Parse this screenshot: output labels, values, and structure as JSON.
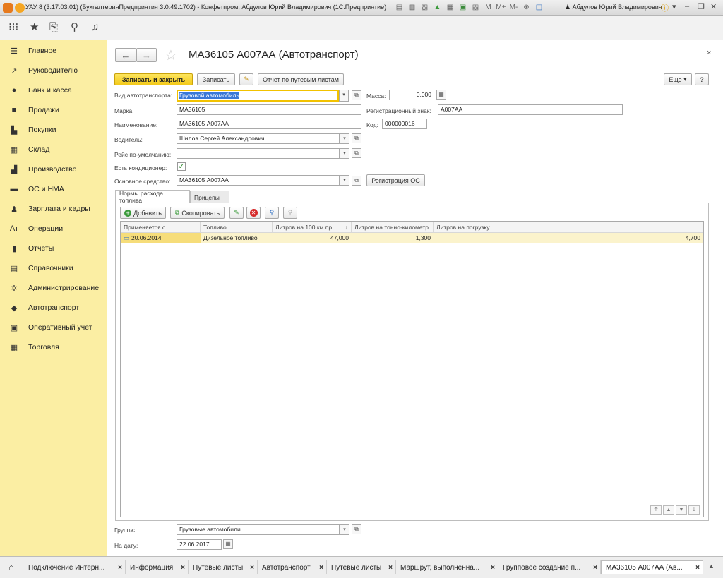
{
  "window": {
    "title": "УАУ 8 (3.17.03.01) (БухгалтерияПредприятия 3.0.49.1702) - Конфетпром, Абдулов Юрий Владимирович  (1С:Предприятие)",
    "user": "Абдулов Юрий Владимирович"
  },
  "sidebar": {
    "items": [
      {
        "label": "Главное",
        "icon": "menu-icon"
      },
      {
        "label": "Руководителю",
        "icon": "trend-icon"
      },
      {
        "label": "Банк и касса",
        "icon": "coin-icon"
      },
      {
        "label": "Продажи",
        "icon": "bag-icon"
      },
      {
        "label": "Покупки",
        "icon": "cart-icon"
      },
      {
        "label": "Склад",
        "icon": "warehouse-icon"
      },
      {
        "label": "Производство",
        "icon": "factory-icon"
      },
      {
        "label": "ОС и НМА",
        "icon": "truck-icon"
      },
      {
        "label": "Зарплата и кадры",
        "icon": "person-icon"
      },
      {
        "label": "Операции",
        "icon": "operations-icon"
      },
      {
        "label": "Отчеты",
        "icon": "bar-chart-icon"
      },
      {
        "label": "Справочники",
        "icon": "book-icon"
      },
      {
        "label": "Администрирование",
        "icon": "gear-icon"
      },
      {
        "label": "Автотранспорт",
        "icon": "car-icon"
      },
      {
        "label": "Оперативный учет",
        "icon": "register-icon"
      },
      {
        "label": "Торговля",
        "icon": "grid-icon"
      }
    ]
  },
  "form": {
    "title": "МА36105 А007АА (Автотранспорт)",
    "buttons": {
      "save_close": "Записать и закрыть",
      "save": "Записать",
      "report": "Отчет по путевым листам",
      "more": "Еще",
      "help": "?",
      "os_registration": "Регистрация ОС"
    },
    "fields": {
      "vehicle_type_label": "Вид автотранспорта:",
      "vehicle_type_value": "Грузовой автомобиль",
      "mass_label": "Масса:",
      "mass_value": "0,000",
      "brand_label": "Марка:",
      "brand_value": "МА36105",
      "reg_label": "Регистрационный знак:",
      "reg_value": "А007АА",
      "name_label": "Наименование:",
      "name_value": "МА36105 А007АА",
      "code_label": "Код:",
      "code_value": "000000016",
      "driver_label": "Водитель:",
      "driver_value": "Шилов Сергей Александрович",
      "route_label": "Рейс по-умолчанию:",
      "route_value": "",
      "ac_label": "Есть кондиционер:",
      "asset_label": "Основное средство:",
      "asset_value": "МА36105 А007АА",
      "group_label": "Группа:",
      "group_value": "Грузовые автомобили",
      "date_label": "На дату:",
      "date_value": "22.06.2017"
    },
    "tabs": [
      "Нормы расхода топлива",
      "Прицепы"
    ],
    "table": {
      "add": "Добавить",
      "copy": "Скопировать",
      "columns": [
        "Применяется с",
        "Топливо",
        "Литров на 100 км пр...",
        "Литров на тонно-километр",
        "Литров на погрузку"
      ],
      "rows": [
        {
          "date": "20.06.2014",
          "fuel": "Дизельное топливо",
          "per100": "47,000",
          "per_tkm": "1,300",
          "per_load": "4,700"
        }
      ]
    }
  },
  "bottom_tabs": [
    "Подключение Интерн...",
    "Информация",
    "Путевые листы",
    "Автотранспорт",
    "Путевые листы",
    "Маршрут, выполненна...",
    "Групповое создание п...",
    "МА36105 А007АА (Ав..."
  ]
}
